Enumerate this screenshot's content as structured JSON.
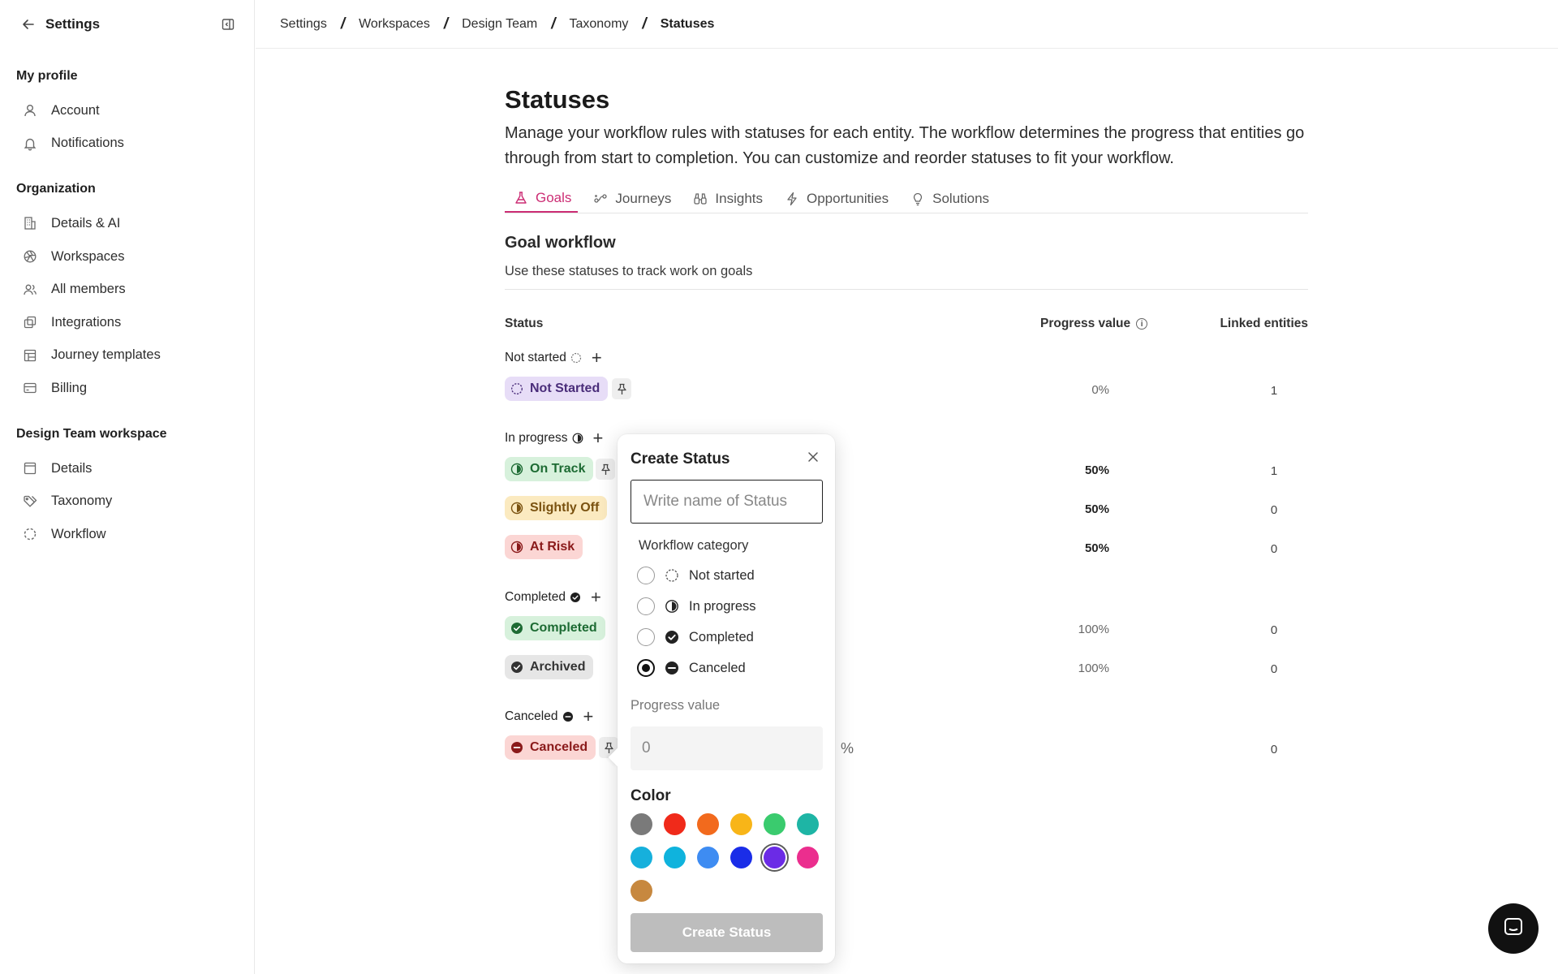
{
  "sidebar": {
    "title": "Settings",
    "sections": [
      {
        "title": "My profile",
        "items": [
          {
            "label": "Account",
            "icon": "user-icon"
          },
          {
            "label": "Notifications",
            "icon": "bell-icon"
          }
        ]
      },
      {
        "title": "Organization",
        "items": [
          {
            "label": "Details & AI",
            "icon": "building-icon"
          },
          {
            "label": "Workspaces",
            "icon": "aperture-icon"
          },
          {
            "label": "All members",
            "icon": "users-icon"
          },
          {
            "label": "Integrations",
            "icon": "layers-icon"
          },
          {
            "label": "Journey templates",
            "icon": "template-icon"
          },
          {
            "label": "Billing",
            "icon": "credit-card-icon"
          }
        ]
      },
      {
        "title": "Design Team workspace",
        "items": [
          {
            "label": "Details",
            "icon": "panel-icon"
          },
          {
            "label": "Taxonomy",
            "icon": "tags-icon"
          },
          {
            "label": "Workflow",
            "icon": "dashed-circle-icon"
          }
        ]
      }
    ]
  },
  "breadcrumb": [
    "Settings",
    "Workspaces",
    "Design Team",
    "Taxonomy",
    "Statuses"
  ],
  "page": {
    "title": "Statuses",
    "description": "Manage your workflow rules with statuses for each entity. The workflow determines the progress that entities go through from start to completion. You can customize and reorder statuses to fit your workflow."
  },
  "tabs": [
    {
      "label": "Goals",
      "icon": "flask-icon",
      "active": true
    },
    {
      "label": "Journeys",
      "icon": "journey-icon",
      "active": false
    },
    {
      "label": "Insights",
      "icon": "binoculars-icon",
      "active": false
    },
    {
      "label": "Opportunities",
      "icon": "bolt-icon",
      "active": false
    },
    {
      "label": "Solutions",
      "icon": "lightbulb-icon",
      "active": false
    }
  ],
  "workflow": {
    "title": "Goal workflow",
    "subtitle": "Use these statuses to track work on goals",
    "columns": {
      "status": "Status",
      "progress": "Progress value",
      "linked": "Linked entities"
    },
    "groups": [
      {
        "label": "Not started",
        "icon": "not-started-icon"
      },
      {
        "label": "In progress",
        "icon": "in-progress-icon"
      },
      {
        "label": "Completed",
        "icon": "completed-icon"
      },
      {
        "label": "Canceled",
        "icon": "canceled-icon"
      }
    ],
    "statuses": [
      {
        "label": "Not Started",
        "progress": "0%",
        "linked": "1"
      },
      {
        "label": "On Track",
        "progress": "50%",
        "linked": "1"
      },
      {
        "label": "Slightly Off",
        "progress": "50%",
        "linked": "0"
      },
      {
        "label": "At Risk",
        "progress": "50%",
        "linked": "0"
      },
      {
        "label": "Completed",
        "progress": "100%",
        "linked": "0"
      },
      {
        "label": "Archived",
        "progress": "100%",
        "linked": "0"
      },
      {
        "label": "Canceled",
        "progress": "",
        "linked": "0"
      }
    ]
  },
  "popover": {
    "title": "Create Status",
    "name_placeholder": "Write name of Status",
    "category_label": "Workflow category",
    "categories": [
      {
        "label": "Not started",
        "checked": false
      },
      {
        "label": "In progress",
        "checked": false
      },
      {
        "label": "Completed",
        "checked": false
      },
      {
        "label": "Canceled",
        "checked": true
      }
    ],
    "progress_label": "Progress value",
    "progress_placeholder": "0",
    "progress_unit": "%",
    "color_label": "Color",
    "colors": [
      "#7a7a7a",
      "#f02a1a",
      "#f26a1d",
      "#f8b518",
      "#3acb6e",
      "#1eb5a5",
      "#16b0dc",
      "#0fb3dd",
      "#3e8cf2",
      "#1a2de8",
      "#6b2be6",
      "#eb2e8e",
      "#c7883f"
    ],
    "selected_color": "#6b2be6",
    "button_label": "Create Status"
  }
}
